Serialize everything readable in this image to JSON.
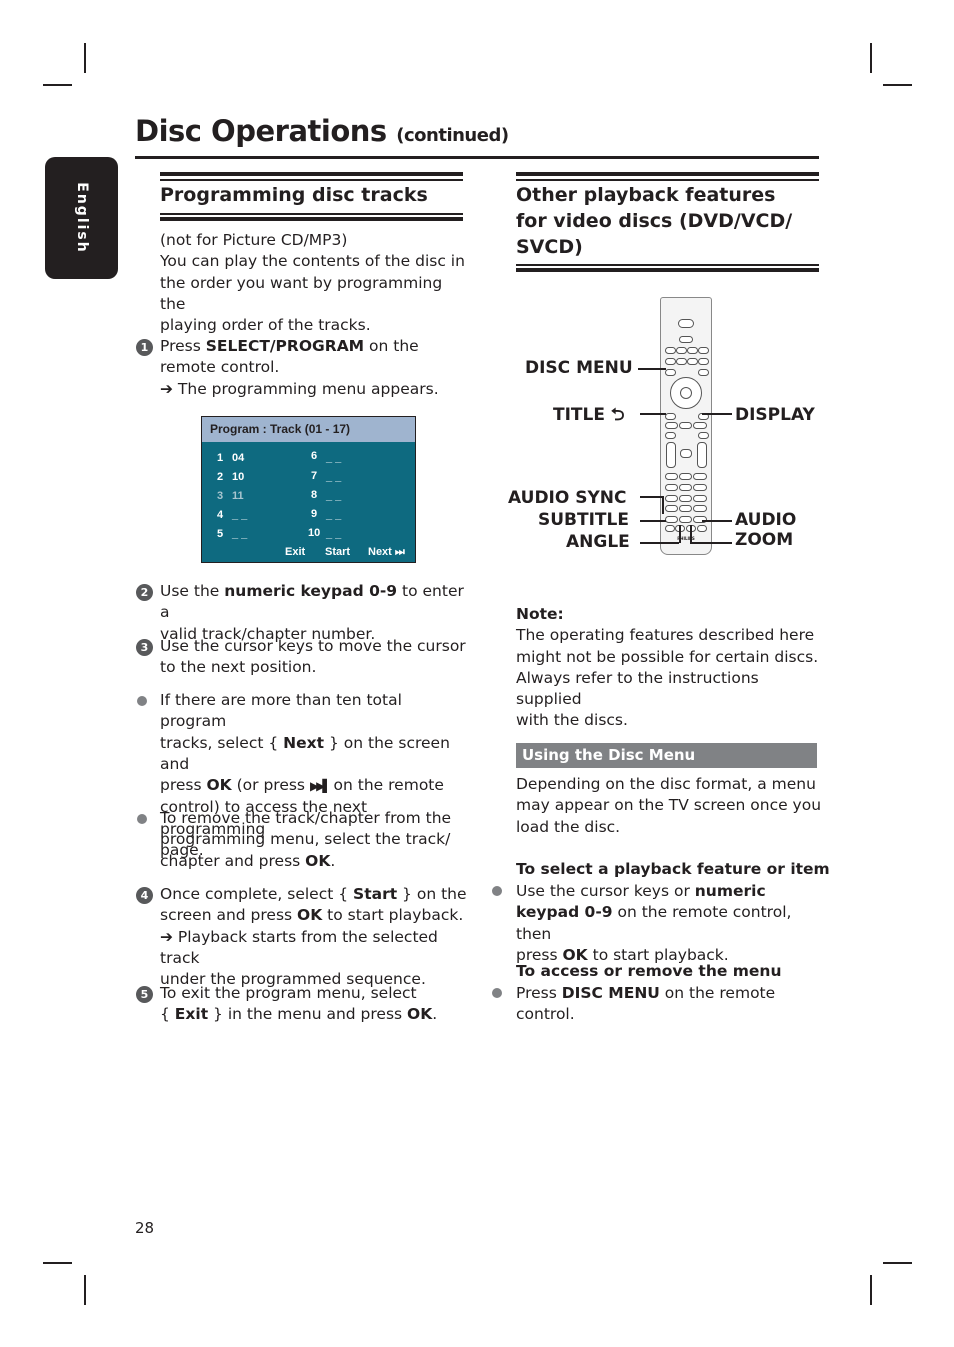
{
  "page": {
    "title": "Disc Operations",
    "title_suffix": "(continued)",
    "language_tab": "English",
    "page_number": "28"
  },
  "left": {
    "heading": "Programming disc tracks",
    "intro_line1": "(not for Picture CD/MP3)",
    "intro_lines": [
      "You can play the contents of the disc in",
      "the order you want by programming the",
      "playing order of the tracks."
    ],
    "step1": {
      "num": "1",
      "pre": "Press ",
      "bold": "SELECT/PROGRAM",
      "post": " on the",
      "line2": "remote control.",
      "result": "➔ The programming menu appears."
    },
    "program_screen": {
      "header": "Program : Track (01 - 17)",
      "left_slots": [
        {
          "slot": "1",
          "value": "04"
        },
        {
          "slot": "2",
          "value": "10"
        },
        {
          "slot": "3",
          "value": "11",
          "highlighted": true
        },
        {
          "slot": "4",
          "value": "_ _"
        },
        {
          "slot": "5",
          "value": "_ _"
        }
      ],
      "right_slots": [
        {
          "slot": "6",
          "value": "_ _"
        },
        {
          "slot": "7",
          "value": "_ _"
        },
        {
          "slot": "8",
          "value": "_ _"
        },
        {
          "slot": "9",
          "value": "_ _"
        },
        {
          "slot": "10",
          "value": "_ _"
        }
      ],
      "buttons": {
        "exit": "Exit",
        "start": "Start",
        "next": "Next ⏭"
      }
    },
    "step2": {
      "num": "2",
      "pre": "Use the ",
      "bold": "numeric keypad 0-9",
      "post": " to enter a",
      "line2": "valid track/chapter number."
    },
    "step3": {
      "num": "3",
      "line1": "Use the cursor keys to move the cursor",
      "line2": "to the next position."
    },
    "bullet1": {
      "line1": "If there are more than ten total program",
      "line2_pre": "tracks, select { ",
      "line2_bold": "Next",
      "line2_post": " } on the screen and",
      "line3_pre": "press ",
      "line3_bold": "OK",
      "line3_mid": " (or press ",
      "line3_icon": "▶▶▌",
      "line3_post": " on the remote",
      "line4": "control) to access the next programming",
      "line5": "page."
    },
    "bullet2": {
      "line1": "To remove the track/chapter from the",
      "line2": "programming menu, select the track/",
      "line3_pre": "chapter and press ",
      "line3_bold": "OK",
      "line3_post": "."
    },
    "step4": {
      "num": "4",
      "line1_pre": "Once complete, select { ",
      "line1_bold": "Start",
      "line1_post": " } on the",
      "line2_pre": "screen and press ",
      "line2_bold": "OK",
      "line2_post": " to start playback.",
      "result1": "➔ Playback starts from the selected track",
      "result2": "under the programmed sequence."
    },
    "step5": {
      "num": "5",
      "line1": "To exit the program menu, select",
      "line2_pre": "{ ",
      "line2_bold": "Exit",
      "line2_mid": " } in the menu and press ",
      "line2_bold2": "OK",
      "line2_post": "."
    }
  },
  "right": {
    "heading_lines": [
      "Other playback features",
      "for video discs (DVD/VCD/",
      "SVCD)"
    ],
    "remote_labels": {
      "disc_menu": "DISC MENU",
      "title": "TITLE ⮌",
      "display": "DISPLAY",
      "audio_sync": "AUDIO SYNC",
      "subtitle": "SUBTITLE",
      "angle": "ANGLE",
      "audio": "AUDIO",
      "zoom": "ZOOM",
      "brand": "PHILIPS"
    },
    "note": {
      "label": "Note:",
      "lines": [
        "The operating features described here",
        "might not be possible for certain discs.",
        "Always refer to the instructions supplied",
        "with the discs."
      ]
    },
    "section_bar": "Using the Disc Menu",
    "section_intro": [
      "Depending on the disc format, a menu",
      "may appear on the TV screen once you",
      "load the disc."
    ],
    "select_feature": {
      "heading": "To select a playback feature or item",
      "line1_pre": "Use the cursor keys or ",
      "line1_bold": "numeric",
      "line2_bold": "keypad 0-9",
      "line2_post": " on the remote control, then",
      "line3_pre": "press ",
      "line3_bold": "OK",
      "line3_post": " to start playback."
    },
    "access_menu": {
      "heading": "To access or remove the menu",
      "line1_pre": "Press ",
      "line1_bold": "DISC MENU",
      "line1_post": " on the remote",
      "line2": "control."
    }
  }
}
